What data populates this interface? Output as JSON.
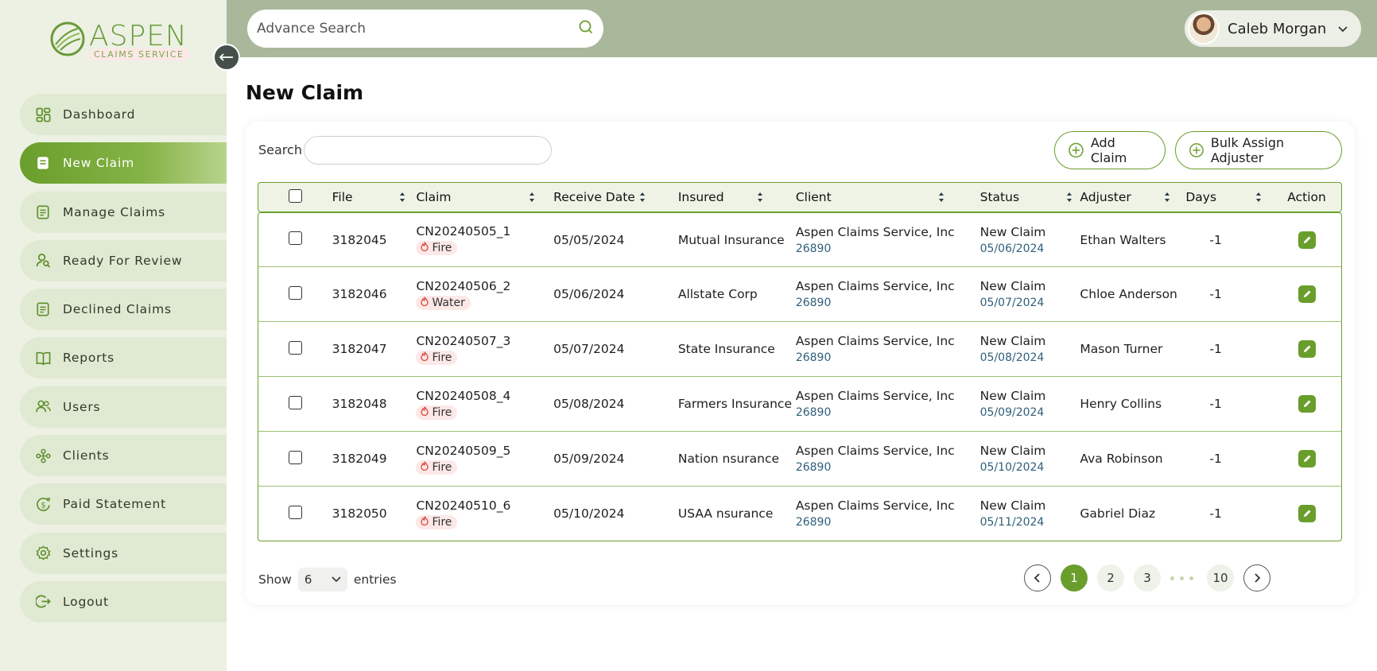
{
  "brand": {
    "name": "ASPEN",
    "tagline": "CLAIMS SERVICE"
  },
  "sidebar": {
    "items": [
      {
        "label": "Dashboard",
        "icon": "dashboard-icon"
      },
      {
        "label": "New Claim",
        "icon": "document-icon",
        "active": true
      },
      {
        "label": "Manage Claims",
        "icon": "list-document-icon"
      },
      {
        "label": "Ready For Review",
        "icon": "user-search-icon"
      },
      {
        "label": "Declined Claims",
        "icon": "list-document-icon"
      },
      {
        "label": "Reports",
        "icon": "book-icon"
      },
      {
        "label": "Users",
        "icon": "users-icon"
      },
      {
        "label": "Clients",
        "icon": "clients-icon"
      },
      {
        "label": "Paid Statement",
        "icon": "dollar-icon"
      },
      {
        "label": "Settings",
        "icon": "gear-icon"
      },
      {
        "label": "Logout",
        "icon": "logout-icon"
      }
    ]
  },
  "header": {
    "search_placeholder": "Advance Search",
    "user_name": "Caleb Morgan"
  },
  "main": {
    "title": "New Claim",
    "search_label": "Search",
    "add_claim_label": "Add Claim",
    "bulk_assign_label": "Bulk Assign Adjuster",
    "columns": [
      "File",
      "Claim",
      "Receive Date",
      "Insured",
      "Client",
      "Status",
      "Adjuster",
      "Days",
      "Action"
    ],
    "rows": [
      {
        "file": "3182045",
        "claim": "CN20240505_1",
        "type": "Fire",
        "receive_date": "05/05/2024",
        "insured": "Mutual Insurance",
        "client": "Aspen Claims Service, Inc",
        "client_id": "26890",
        "status": "New Claim",
        "status_date": "05/06/2024",
        "adjuster": "Ethan Walters",
        "days": "-1"
      },
      {
        "file": "3182046",
        "claim": "CN20240506_2",
        "type": "Water",
        "receive_date": "05/06/2024",
        "insured": "Allstate Corp",
        "client": "Aspen Claims Service, Inc",
        "client_id": "26890",
        "status": "New Claim",
        "status_date": "05/07/2024",
        "adjuster": "Chloe Anderson",
        "days": "-1"
      },
      {
        "file": "3182047",
        "claim": "CN20240507_3",
        "type": "Fire",
        "receive_date": "05/07/2024",
        "insured": "State Insurance",
        "client": "Aspen Claims Service, Inc",
        "client_id": "26890",
        "status": "New Claim",
        "status_date": "05/08/2024",
        "adjuster": "Mason Turner",
        "days": "-1"
      },
      {
        "file": "3182048",
        "claim": "CN20240508_4",
        "type": "Fire",
        "receive_date": "05/08/2024",
        "insured": "Farmers Insurance",
        "client": "Aspen Claims Service, Inc",
        "client_id": "26890",
        "status": "New Claim",
        "status_date": "05/09/2024",
        "adjuster": "Henry Collins",
        "days": "-1"
      },
      {
        "file": "3182049",
        "claim": "CN20240509_5",
        "type": "Fire",
        "receive_date": "05/09/2024",
        "insured": "Nation nsurance",
        "client": "Aspen Claims Service, Inc",
        "client_id": "26890",
        "status": "New Claim",
        "status_date": "05/10/2024",
        "adjuster": "Ava Robinson",
        "days": "-1"
      },
      {
        "file": "3182050",
        "claim": "CN20240510_6",
        "type": "Fire",
        "receive_date": "05/10/2024",
        "insured": "USAA nsurance",
        "client": "Aspen Claims Service, Inc",
        "client_id": "26890",
        "status": "New Claim",
        "status_date": "05/11/2024",
        "adjuster": "Gabriel Diaz",
        "days": "-1"
      }
    ],
    "show_label": "Show",
    "entries_value": "6",
    "entries_label": "entries",
    "pages": [
      "1",
      "2",
      "3",
      "10"
    ],
    "current_page": "1"
  },
  "colors": {
    "accent": "#6a9e2c",
    "sidebar_bg": "#ecf1e4",
    "header_bg": "#a9b89a",
    "status_date": "#2f5f7a"
  }
}
